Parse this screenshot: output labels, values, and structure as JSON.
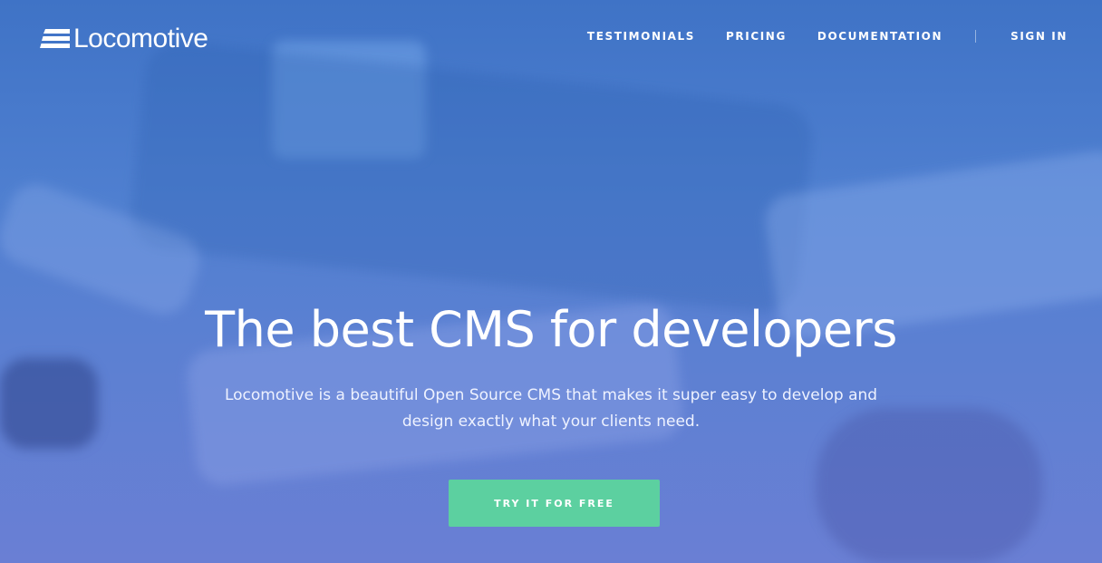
{
  "brand": {
    "name": "Locomotive",
    "logo_icon": "stacked-bars-logo"
  },
  "nav": {
    "items": [
      {
        "label": "TESTIMONIALS"
      },
      {
        "label": "PRICING"
      },
      {
        "label": "DOCUMENTATION"
      }
    ],
    "sign_in": "SIGN IN"
  },
  "hero": {
    "title": "The best CMS for developers",
    "subtitle": "Locomotive is a beautiful Open Source CMS that makes it super easy to develop and design exactly what your clients need.",
    "cta_label": "TRY IT FOR FREE"
  },
  "colors": {
    "overlay": "#4f7fd0",
    "cta": "#5cd0a0"
  }
}
